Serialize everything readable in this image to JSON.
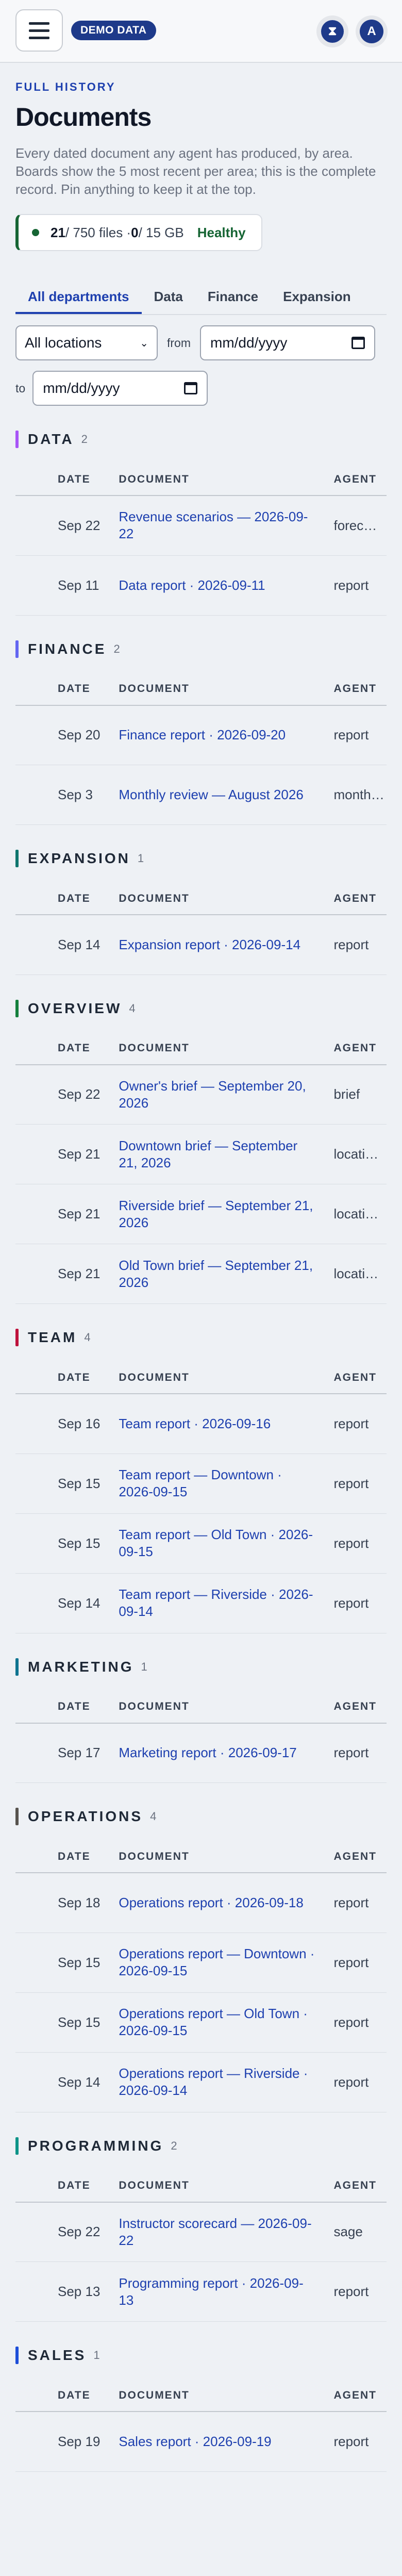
{
  "topbar": {
    "menu_icon": "hamburger-icon",
    "badge": "DEMO DATA",
    "status_icon": "hourglass-icon",
    "status_glyph": "⧗",
    "avatar_initial": "A"
  },
  "header": {
    "eyebrow": "FULL HISTORY",
    "title": "Documents",
    "subtitle": "Every dated document any agent has produced, by area. Boards show the 5 most recent per area; this is the complete record. Pin anything to keep it at the top."
  },
  "health": {
    "files": "21",
    "files_total": " / 750 files · ",
    "storage": "0",
    "storage_total": " / 15 GB",
    "status": "Healthy",
    "status_color": "#166534"
  },
  "tabs": [
    "All departments",
    "Data",
    "Finance",
    "Expansion"
  ],
  "filters": {
    "location": "All locations",
    "from_label": "from",
    "from_placeholder": "mm/dd/yyyy",
    "to_label": "to",
    "to_placeholder": "mm/dd/yyyy"
  },
  "columns": {
    "date": "DATE",
    "document": "DOCUMENT",
    "agent": "AGENT"
  },
  "sections": [
    {
      "name": "DATA",
      "count": "2",
      "color": "#a855f7",
      "rows": [
        {
          "date": "Sep 22",
          "doc": "Revenue scenarios — 2026-09-22",
          "agent": "forec…"
        },
        {
          "date": "Sep 11",
          "doc": "Data report · 2026-09-11",
          "agent": "report"
        }
      ]
    },
    {
      "name": "FINANCE",
      "count": "2",
      "color": "#6366f1",
      "rows": [
        {
          "date": "Sep 20",
          "doc": "Finance report · 2026-09-20",
          "agent": "report"
        },
        {
          "date": "Sep 3",
          "doc": "Monthly review — August 2026",
          "agent": "month…"
        }
      ]
    },
    {
      "name": "EXPANSION",
      "count": "1",
      "color": "#0f766e",
      "rows": [
        {
          "date": "Sep 14",
          "doc": "Expansion report · 2026-09-14",
          "agent": "report"
        }
      ]
    },
    {
      "name": "OVERVIEW",
      "count": "4",
      "color": "#15803d",
      "rows": [
        {
          "date": "Sep 22",
          "doc": "Owner's brief — September 20, 2026",
          "agent": "brief"
        },
        {
          "date": "Sep 21",
          "doc": "Downtown brief — September 21, 2026",
          "agent": "locati…"
        },
        {
          "date": "Sep 21",
          "doc": "Riverside brief — September 21, 2026",
          "agent": "locati…"
        },
        {
          "date": "Sep 21",
          "doc": "Old Town brief — September 21, 2026",
          "agent": "locati…"
        }
      ]
    },
    {
      "name": "TEAM",
      "count": "4",
      "color": "#be123c",
      "rows": [
        {
          "date": "Sep 16",
          "doc": "Team report · 2026-09-16",
          "agent": "report"
        },
        {
          "date": "Sep 15",
          "doc": "Team report — Downtown · 2026-09-15",
          "agent": "report"
        },
        {
          "date": "Sep 15",
          "doc": "Team report — Old Town · 2026-09-15",
          "agent": "report"
        },
        {
          "date": "Sep 14",
          "doc": "Team report — Riverside · 2026-09-14",
          "agent": "report"
        }
      ]
    },
    {
      "name": "MARKETING",
      "count": "1",
      "color": "#0e7490",
      "rows": [
        {
          "date": "Sep 17",
          "doc": "Marketing report · 2026-09-17",
          "agent": "report"
        }
      ]
    },
    {
      "name": "OPERATIONS",
      "count": "4",
      "color": "#57534e",
      "rows": [
        {
          "date": "Sep 18",
          "doc": "Operations report · 2026-09-18",
          "agent": "report"
        },
        {
          "date": "Sep 15",
          "doc": "Operations report — Downtown · 2026-09-15",
          "agent": "report"
        },
        {
          "date": "Sep 15",
          "doc": "Operations report — Old Town · 2026-09-15",
          "agent": "report"
        },
        {
          "date": "Sep 14",
          "doc": "Operations report — Riverside · 2026-09-14",
          "agent": "report"
        }
      ]
    },
    {
      "name": "PROGRAMMING",
      "count": "2",
      "color": "#0d9488",
      "rows": [
        {
          "date": "Sep 22",
          "doc": "Instructor scorecard — 2026-09-22",
          "agent": "sage"
        },
        {
          "date": "Sep 13",
          "doc": "Programming report · 2026-09-13",
          "agent": "report"
        }
      ]
    },
    {
      "name": "SALES",
      "count": "1",
      "color": "#1d4ed8",
      "rows": [
        {
          "date": "Sep 19",
          "doc": "Sales report · 2026-09-19",
          "agent": "report"
        }
      ]
    }
  ]
}
